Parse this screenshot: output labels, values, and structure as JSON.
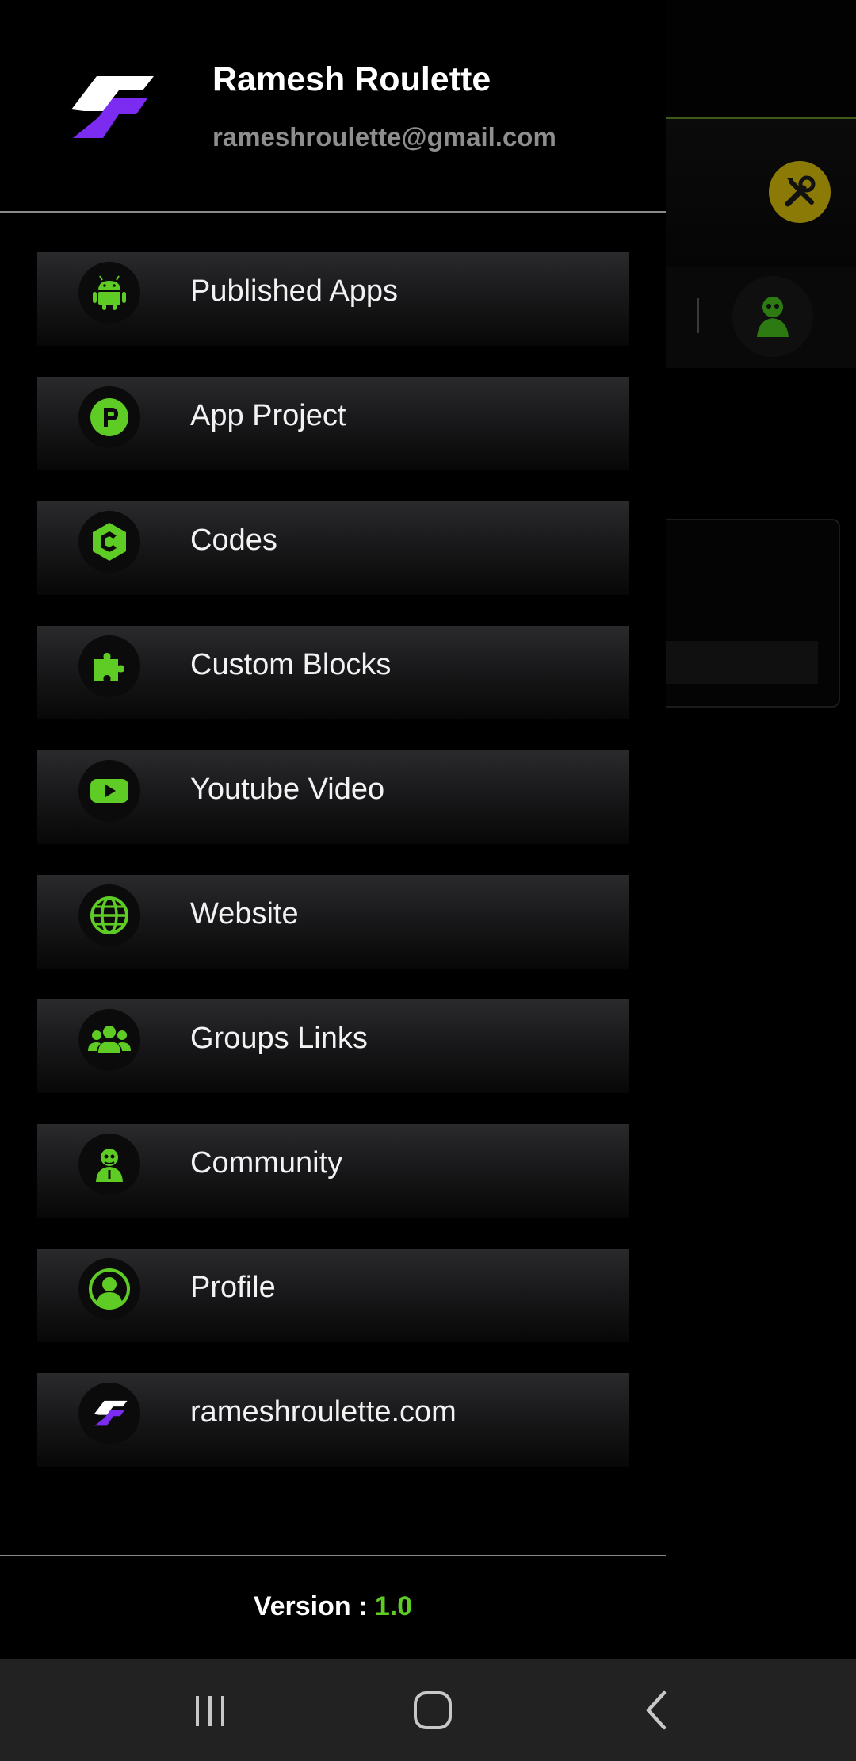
{
  "user": {
    "name": "Ramesh Roulette",
    "email": "rameshroulette@gmail.com"
  },
  "menu": {
    "items": [
      {
        "label": "Published Apps",
        "icon": "android-icon"
      },
      {
        "label": "App Project",
        "icon": "p-badge-icon"
      },
      {
        "label": "Codes",
        "icon": "c-badge-icon"
      },
      {
        "label": "Custom Blocks",
        "icon": "puzzle-icon"
      },
      {
        "label": "Youtube Video",
        "icon": "youtube-icon"
      },
      {
        "label": "Website",
        "icon": "globe-icon"
      },
      {
        "label": "Groups Links",
        "icon": "group-icon"
      },
      {
        "label": "Community",
        "icon": "community-icon"
      },
      {
        "label": "Profile",
        "icon": "profile-icon"
      },
      {
        "label": "rameshroulette.com",
        "icon": "brand-logo-icon"
      }
    ]
  },
  "footer": {
    "version_label": "Version : ",
    "version_value": "1.0"
  },
  "colors": {
    "accent": "#5fcc26",
    "brand_purple": "#7c2cf0",
    "tools_button": "#8c7a06"
  }
}
